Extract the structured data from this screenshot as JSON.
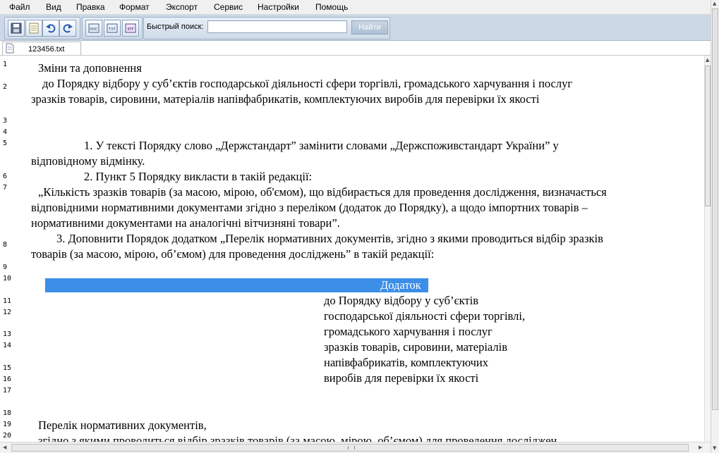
{
  "menu": [
    "Файл",
    "Вид",
    "Правка",
    "Формат",
    "Экспорт",
    "Сервис",
    "Настройки",
    "Помощь"
  ],
  "toolbar": {
    "search_label": "Быстрый поиск:",
    "search_value": "",
    "search_button": "Найти",
    "buttons": [
      "save-icon",
      "new-document-icon",
      "undo-icon",
      "redo-icon",
      "export-doc-icon",
      "export-txt-icon",
      "export-rtf-icon"
    ],
    "export_labels": [
      "DOC",
      "TXT",
      "RTF"
    ]
  },
  "tab": {
    "label": "123456.txt"
  },
  "editor": {
    "line_numbers": [
      "1",
      "2",
      "3",
      "4",
      "5",
      "6",
      "7",
      "8",
      "9",
      "10",
      "11",
      "12",
      "13",
      "14",
      "15",
      "16",
      "17",
      "18",
      "19",
      "20"
    ],
    "lines": [
      "Зміни та доповнення",
      "до Порядку відбору у суб’єктів господарської діяльності сфери торгівлі, громадського харчування і послуг",
      "зразків товарів, сировини, матеріалів напівфабрикатів, комплектуючих виробів для перевірки їх якості",
      "1. У тексті Порядку слово „Держстандарт” замінити словами      „Держспоживстандарт України” у",
      "відповідному відмінку.",
      "2. Пункт 5 Порядку викласти в такій редакції:",
      "„Кількість зразків товарів (за масою, мірою, об'ємом), що відбирається для проведення дослідження, визначається",
      "відповідними нормативними документами згідно з переліком (додаток до Порядку), а щодо імпортних товарів –",
      "нормативними документами на аналогічні вітчизняні товари”.",
      "3. Доповнити Порядок додатком „Перелік нормативних документів, згідно з якими проводиться відбір зразків",
      "товарів (за масою, мірою, об’ємом) для проведення досліджень” в такій редакції:",
      "Додаток",
      "до Порядку відбору у суб’єктів",
      "господарської діяльності сфери торгівлі,",
      "громадського харчування і послуг",
      "зразків товарів, сировини, матеріалів",
      "напівфабрикатів, комплектуючих",
      "виробів для перевірки їх якості",
      "Перелік нормативних документів,",
      "згідно з якими проводиться відбір зразків товарів (за масою, мірою, об’ємом) для проведення досліджен"
    ]
  },
  "colors": {
    "toolbar_bg": "#ccd8e6",
    "selection": "#3c8ee7",
    "menubar_bg": "#f0f0f0"
  }
}
